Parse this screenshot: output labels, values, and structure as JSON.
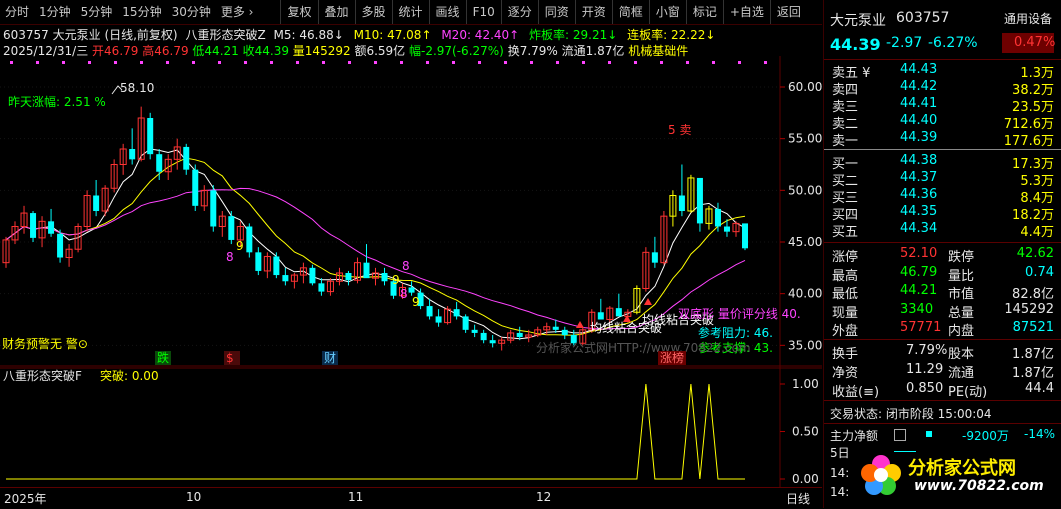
{
  "toolbar": {
    "periods": [
      "分时",
      "1分钟",
      "5分钟",
      "15分钟",
      "30分钟",
      "更多 ›"
    ],
    "tools": [
      "复权",
      "叠加",
      "多股",
      "统计",
      "画线",
      "F10",
      "逐分",
      "同资",
      "开资",
      "简框",
      "小窗",
      "标记",
      "+自选",
      "返回"
    ]
  },
  "info": {
    "stock_line": "603757 大元泵业 (日线,前复权)",
    "indicator_name": "八重形态突破Z",
    "m5": "M5: 46.88↓",
    "m10": "M10: 47.08↑",
    "m20": "M20: 42.40↑",
    "zha": "炸板率: 29.21↓",
    "lian": "连板率: 22.22↓",
    "date": "2025/12/31/三",
    "open": "开46.79",
    "high": "高46.79",
    "low": "低44.21",
    "close": "收44.39",
    "vol": "量145292",
    "amount": "额6.59亿",
    "change": "幅-2.97(-6.27%)",
    "turnover": "换7.79%",
    "float": "流通1.87亿",
    "sector": "机械基础件"
  },
  "chart_labels": {
    "high_mark": "58.10",
    "yesterday": "昨天涨幅: 2.51 %",
    "finance": "财务预警无  警⊙",
    "watermark": "分析家公式网HTTP://www.70822.com",
    "sell_label": "5 卖",
    "support_break": "均线粘合突破",
    "support_break2": "均线粘合突破",
    "ref_resist": "参考阻力: 46.",
    "ref_support": "参考支撑: 43.",
    "double_bottom": "双底形 量价评分线 40.",
    "m_die": "跌",
    "m_dollar": "$",
    "m_cai": "财",
    "m_zhang": "涨榜",
    "nine_labels": [
      "8",
      "9",
      "8",
      "9",
      "8",
      "9"
    ],
    "sub_title": "八重形态突破F",
    "sub_value": "突破: 0.00"
  },
  "y_axis": [
    "60.00",
    "55.00",
    "50.00",
    "45.00",
    "40.00",
    "35.00"
  ],
  "sub_y_axis": [
    "1.00",
    "0.50",
    "0.00"
  ],
  "x_axis": [
    "2025年",
    "10",
    "11",
    "12",
    "日线"
  ],
  "quote": {
    "name": "大元泵业",
    "code": "603757",
    "settings": "通用设备",
    "price": "44.39",
    "change": "-2.97",
    "pct": "-6.27%",
    "weibi": "0.47%",
    "asks": [
      {
        "label": "卖五 ¥",
        "price": "44.43",
        "vol": "1.3万"
      },
      {
        "label": "卖四",
        "price": "44.42",
        "vol": "38.2万"
      },
      {
        "label": "卖三",
        "price": "44.41",
        "vol": "23.5万"
      },
      {
        "label": "卖二",
        "price": "44.40",
        "vol": "712.6万"
      },
      {
        "label": "卖一",
        "price": "44.39",
        "vol": "177.6万"
      }
    ],
    "bids": [
      {
        "label": "买一",
        "price": "44.38",
        "vol": "17.3万"
      },
      {
        "label": "买二",
        "price": "44.37",
        "vol": "5.3万"
      },
      {
        "label": "买三",
        "price": "44.36",
        "vol": "8.4万"
      },
      {
        "label": "买四",
        "price": "44.35",
        "vol": "18.2万"
      },
      {
        "label": "买五",
        "price": "44.34",
        "vol": "4.4万"
      }
    ],
    "stats1": [
      {
        "l1": "涨停",
        "v1": "52.10",
        "c1": "#ff3333",
        "l2": "跌停",
        "v2": "42.62",
        "c2": "#00ff00"
      },
      {
        "l1": "最高",
        "v1": "46.79",
        "c1": "#00ff00",
        "l2": "量比",
        "v2": "0.74",
        "c2": "#00ffff"
      },
      {
        "l1": "最低",
        "v1": "44.21",
        "c1": "#00ff00",
        "l2": "市值",
        "v2": "82.8亿",
        "c2": "#e6e6e6"
      },
      {
        "l1": "现量",
        "v1": "3340",
        "c1": "#00ff00",
        "l2": "总量",
        "v2": "145292",
        "c2": "#e6e6e6"
      },
      {
        "l1": "外盘",
        "v1": "57771",
        "c1": "#ff3333",
        "l2": "内盘",
        "v2": "87521",
        "c2": "#00ffff"
      }
    ],
    "stats2": [
      {
        "l1": "换手",
        "v1": "7.79%",
        "l2": "股本",
        "v2": "1.87亿"
      },
      {
        "l1": "净资",
        "v1": "11.29",
        "l2": "流通",
        "v2": "1.87亿"
      },
      {
        "l1": "收益(≡)",
        "v1": "0.850",
        "l2": "PE(动)",
        "v2": "44.4"
      }
    ],
    "trade_state": "交易状态: 闭市阶段 15:00:04",
    "main_flow_label": "主力净额",
    "main_flow_value": "-9200万",
    "main_flow_pct": "-14%",
    "five_day": "5日",
    "time1": "14:",
    "time2": "14:",
    "logo_text": "分析家公式网",
    "logo_url": "www.70822.com"
  },
  "colors": {
    "up": "#ff3333",
    "down": "#00ffff",
    "ma5": "#ffffff",
    "ma10": "#ffff00",
    "ma20": "#ff44ff",
    "grid": "#5a0000"
  },
  "chart_data": {
    "type": "candlestick",
    "title": "603757 大元泵业 (日线,前复权)",
    "ylim": [
      33,
      63
    ],
    "x": [
      "2025年",
      "10",
      "11",
      "12"
    ],
    "candles": [
      [
        43.0,
        45.5,
        42.5,
        45.2
      ],
      [
        45.2,
        47.0,
        44.8,
        46.5
      ],
      [
        46.5,
        48.5,
        45.8,
        47.8
      ],
      [
        47.8,
        48.0,
        45.0,
        45.4
      ],
      [
        45.4,
        47.5,
        44.5,
        47.0
      ],
      [
        47.0,
        48.2,
        45.5,
        45.8
      ],
      [
        45.8,
        46.2,
        43.0,
        43.5
      ],
      [
        43.5,
        44.8,
        42.6,
        44.3
      ],
      [
        44.3,
        46.8,
        44.0,
        46.5
      ],
      [
        46.5,
        50.0,
        46.0,
        49.5
      ],
      [
        49.5,
        51.0,
        47.5,
        48.0
      ],
      [
        48.0,
        50.5,
        47.5,
        50.2
      ],
      [
        50.2,
        53.0,
        49.8,
        52.5
      ],
      [
        52.5,
        54.5,
        51.5,
        54.0
      ],
      [
        54.0,
        56.0,
        52.5,
        53.0
      ],
      [
        53.0,
        58.1,
        52.8,
        57.0
      ],
      [
        57.0,
        57.5,
        53.0,
        53.5
      ],
      [
        53.5,
        54.0,
        51.0,
        51.8
      ],
      [
        51.8,
        53.5,
        51.0,
        53.0
      ],
      [
        53.0,
        55.0,
        52.0,
        54.2
      ],
      [
        54.2,
        54.5,
        51.5,
        52.0
      ],
      [
        52.0,
        52.5,
        48.0,
        48.5
      ],
      [
        48.5,
        50.5,
        48.0,
        50.0
      ],
      [
        50.0,
        50.5,
        46.0,
        46.5
      ],
      [
        46.5,
        48.0,
        45.5,
        47.5
      ],
      [
        47.5,
        48.0,
        44.8,
        45.2
      ],
      [
        45.2,
        47.0,
        44.5,
        46.5
      ],
      [
        46.5,
        46.8,
        43.5,
        44.0
      ],
      [
        44.0,
        44.5,
        41.8,
        42.2
      ],
      [
        42.2,
        44.0,
        41.5,
        43.6
      ],
      [
        43.6,
        44.0,
        41.5,
        41.8
      ],
      [
        41.8,
        42.5,
        40.8,
        41.2
      ],
      [
        41.2,
        42.0,
        40.5,
        41.8
      ],
      [
        41.8,
        43.0,
        41.0,
        42.5
      ],
      [
        42.5,
        42.8,
        40.8,
        41.0
      ],
      [
        41.0,
        41.5,
        39.8,
        40.2
      ],
      [
        40.2,
        41.5,
        39.8,
        41.2
      ],
      [
        41.2,
        42.5,
        40.8,
        42.0
      ],
      [
        42.0,
        42.2,
        40.8,
        41.3
      ],
      [
        41.3,
        43.5,
        41.0,
        43.0
      ],
      [
        43.0,
        44.8,
        42.5,
        41.5
      ],
      [
        41.5,
        42.5,
        40.8,
        42.0
      ],
      [
        42.0,
        42.5,
        40.8,
        41.2
      ],
      [
        41.2,
        41.5,
        39.5,
        39.8
      ],
      [
        39.8,
        41.0,
        39.5,
        40.6
      ],
      [
        40.6,
        41.2,
        39.8,
        40.1
      ],
      [
        40.1,
        40.5,
        38.5,
        38.8
      ],
      [
        38.8,
        39.5,
        37.5,
        37.8
      ],
      [
        37.8,
        38.5,
        36.8,
        37.2
      ],
      [
        37.2,
        38.8,
        37.0,
        38.5
      ],
      [
        38.5,
        39.2,
        37.5,
        37.8
      ],
      [
        37.8,
        38.0,
        36.2,
        36.5
      ],
      [
        36.5,
        37.0,
        35.8,
        36.2
      ],
      [
        36.2,
        36.5,
        35.2,
        35.5
      ],
      [
        35.5,
        36.0,
        34.8,
        35.2
      ],
      [
        35.2,
        35.8,
        34.5,
        35.5
      ],
      [
        35.5,
        36.5,
        35.2,
        36.2
      ],
      [
        36.2,
        36.8,
        35.5,
        35.8
      ],
      [
        35.8,
        36.5,
        35.3,
        36.0
      ],
      [
        36.0,
        36.8,
        35.8,
        36.5
      ],
      [
        36.5,
        37.2,
        36.0,
        36.8
      ],
      [
        36.8,
        37.5,
        36.2,
        36.5
      ],
      [
        36.5,
        36.8,
        35.6,
        36.0
      ],
      [
        36.0,
        36.5,
        35.0,
        35.2
      ],
      [
        35.2,
        36.8,
        35.0,
        36.5
      ],
      [
        36.5,
        38.5,
        36.2,
        38.2
      ],
      [
        38.2,
        39.5,
        37.8,
        37.5
      ],
      [
        37.5,
        38.8,
        37.2,
        38.6
      ],
      [
        38.6,
        40.0,
        38.0,
        37.8
      ],
      [
        37.8,
        38.5,
        37.2,
        38.2
      ],
      [
        38.2,
        40.8,
        38.0,
        40.5
      ],
      [
        40.5,
        44.5,
        40.2,
        44.0
      ],
      [
        44.0,
        45.5,
        42.5,
        43.0
      ],
      [
        43.0,
        48.0,
        42.8,
        47.5
      ],
      [
        47.5,
        50.0,
        46.5,
        49.5
      ],
      [
        49.5,
        52.5,
        47.5,
        48.0
      ],
      [
        48.0,
        51.5,
        47.8,
        51.2
      ],
      [
        51.2,
        49.5,
        46.0,
        46.8
      ],
      [
        46.8,
        48.5,
        46.2,
        48.2
      ],
      [
        48.2,
        48.8,
        46.0,
        46.5
      ],
      [
        46.5,
        47.2,
        45.5,
        46.0
      ],
      [
        46.0,
        47.0,
        45.5,
        46.8
      ],
      [
        46.8,
        46.79,
        44.21,
        44.39
      ]
    ],
    "signal_series": {
      "name": "突破",
      "spikes_at_index": [
        71,
        76,
        78
      ],
      "last": 0.0
    }
  }
}
